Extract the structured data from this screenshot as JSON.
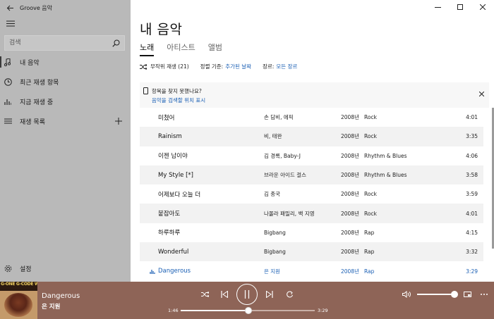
{
  "app": {
    "title": "Groove 음악"
  },
  "sidebar": {
    "search_placeholder": "검색",
    "items": [
      {
        "label": "내 음악"
      },
      {
        "label": "최근 재생 항목"
      },
      {
        "label": "지금 재생 중"
      },
      {
        "label": "재생 목록"
      }
    ],
    "settings_label": "설정"
  },
  "main": {
    "title": "내 음악",
    "tabs": [
      {
        "label": "노래"
      },
      {
        "label": "아티스트"
      },
      {
        "label": "앨범"
      }
    ],
    "filters": {
      "shuffle_label": "무작위 재생 (21)",
      "sort_label": "정렬 기준:",
      "sort_value": "추가된 날짜",
      "genre_label": "장르:",
      "genre_value": "모든 장르"
    },
    "notice": {
      "text": "항목을 찾지 못했나요?",
      "link": "음악을 검색할 위치 표시"
    },
    "songs": [
      {
        "title": "미쳤어",
        "artist": "손 담비, 에픽",
        "year": "2008년",
        "genre": "Rock",
        "duration": "4:01"
      },
      {
        "title": "Rainism",
        "artist": "비, 태완",
        "year": "2008년",
        "genre": "Rock",
        "duration": "3:35"
      },
      {
        "title": "이젠 남이야",
        "artist": "김 경록, Baby-J",
        "year": "2008년",
        "genre": "Rhythm & Blues",
        "duration": "4:06"
      },
      {
        "title": "My Style [*]",
        "artist": "브라운 아이드 걸스",
        "year": "2008년",
        "genre": "Rhythm & Blues",
        "duration": "3:58"
      },
      {
        "title": "어제보다 오늘 더",
        "artist": "김 종국",
        "year": "2008년",
        "genre": "Rock",
        "duration": "3:59"
      },
      {
        "title": "붙잡아도",
        "artist": "나몰라 패밀리, 백 지영",
        "year": "2008년",
        "genre": "Rock",
        "duration": "4:01"
      },
      {
        "title": "하루하루",
        "artist": "Bigbang",
        "year": "2008년",
        "genre": "Rap",
        "duration": "4:15"
      },
      {
        "title": "Wonderful",
        "artist": "Bigbang",
        "year": "2008년",
        "genre": "Rap",
        "duration": "3:32"
      },
      {
        "title": "Dangerous",
        "artist": "은 지원",
        "year": "2008년",
        "genre": "Rap",
        "duration": "3:29"
      }
    ]
  },
  "player": {
    "album_art_text": "G-ONE G-CODE WILD SIDE RESERV",
    "title": "Dangerous",
    "artist": "은 지원",
    "elapsed": "1:46",
    "total": "3:29",
    "progress_fraction": 0.507,
    "volume_fraction": 1.0
  },
  "colors": {
    "sidebar_bg": "#b9b9b9",
    "player_bg": "#8e6457",
    "accent": "#1a5fb4"
  }
}
